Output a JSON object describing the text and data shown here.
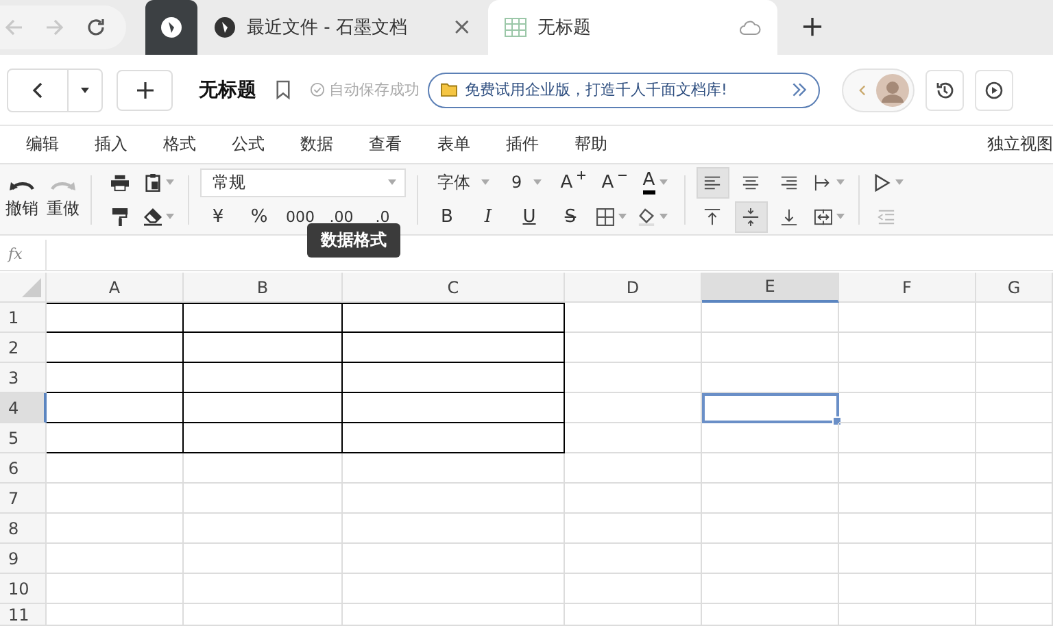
{
  "browser": {
    "tabs": [
      {
        "kind": "pinned",
        "selected": false
      },
      {
        "kind": "page",
        "title": "最近文件 - 石墨文档",
        "close": "×",
        "selected": false
      },
      {
        "kind": "sheet",
        "title": "无标题",
        "selected": true
      }
    ]
  },
  "doc_bar": {
    "title": "无标题",
    "save_status": "自动保存成功",
    "promo": "免费试用企业版，打造千人千面文档库!"
  },
  "menu": {
    "items": [
      "编辑",
      "插入",
      "格式",
      "公式",
      "数据",
      "查看",
      "表单",
      "插件",
      "帮助"
    ],
    "right": "独立视图"
  },
  "toolbar": {
    "undo": "撤销",
    "redo": "重做",
    "number_format": "常规",
    "currency": "¥",
    "percent": "%",
    "thousands": "000",
    "add_decimal": ".00",
    "remove_decimal": ".0",
    "font": "字体",
    "font_size": "9",
    "bold": "B",
    "italic": "I",
    "underline": "U",
    "strike": "S",
    "font_up": "A",
    "font_down": "A",
    "font_color": "A",
    "h_align": [
      {
        "selected": true
      },
      {
        "selected": false
      },
      {
        "selected": false
      }
    ],
    "v_align": [
      {
        "selected": false
      },
      {
        "selected": true
      },
      {
        "selected": false
      }
    ]
  },
  "tooltip": "数据格式",
  "formula_bar": {
    "label": "fx"
  },
  "sheet": {
    "columns": [
      {
        "label": "A",
        "bordered": true,
        "selected": false
      },
      {
        "label": "B",
        "bordered": true,
        "selected": false
      },
      {
        "label": "C",
        "bordered": true,
        "selected": false
      },
      {
        "label": "D",
        "bordered": false,
        "selected": false
      },
      {
        "label": "E",
        "bordered": false,
        "selected": true
      },
      {
        "label": "F",
        "bordered": false,
        "selected": false
      },
      {
        "label": "G",
        "bordered": false,
        "selected": false
      }
    ],
    "rows": [
      {
        "label": "1",
        "bordered": true,
        "selected": false
      },
      {
        "label": "2",
        "bordered": true,
        "selected": false
      },
      {
        "label": "3",
        "bordered": true,
        "selected": false
      },
      {
        "label": "4",
        "bordered": true,
        "selected": true
      },
      {
        "label": "5",
        "bordered": true,
        "selected": false
      },
      {
        "label": "6",
        "bordered": false,
        "selected": false
      },
      {
        "label": "7",
        "bordered": false,
        "selected": false
      },
      {
        "label": "8",
        "bordered": false,
        "selected": false
      },
      {
        "label": "9",
        "bordered": false,
        "selected": false
      },
      {
        "label": "10",
        "bordered": false,
        "selected": false
      },
      {
        "label": "11",
        "bordered": false,
        "selected": false
      }
    ]
  }
}
